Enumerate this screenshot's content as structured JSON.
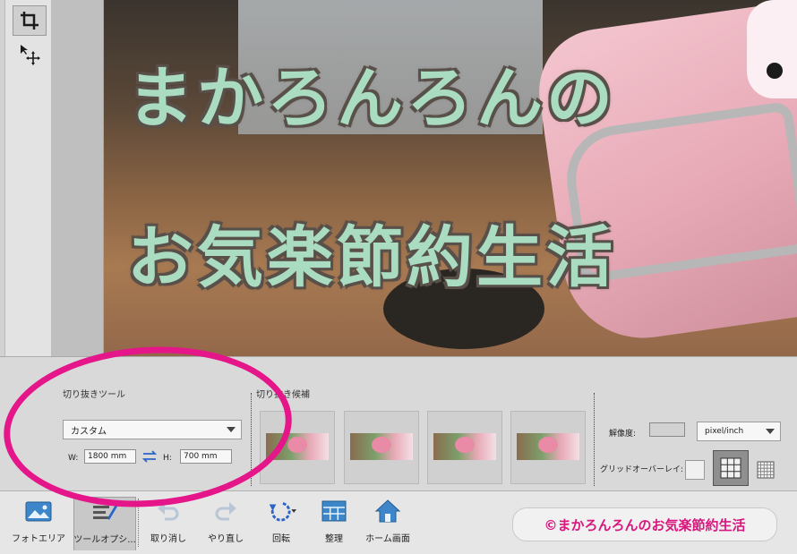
{
  "canvas": {
    "title_line1": "まかろんろんの",
    "title_line2": "お気楽節約生活"
  },
  "tools": {
    "crop": "crop-tool",
    "move": "move-tool"
  },
  "options": {
    "crop_section_label": "切り抜きツール",
    "preset_selected": "カスタム",
    "width_label": "W:",
    "width_value": "1800 mm",
    "height_label": "H:",
    "height_value": "700 mm",
    "suggestions_label": "切り抜き候補",
    "suggestion_count": 4,
    "resolution_label": "解像度:",
    "resolution_value": "",
    "unit_selected": "pixel/inch",
    "grid_overlay_label": "グリッドオーバーレイ:",
    "grid_selected": "thirds"
  },
  "taskbar": {
    "photo_area": "フォトエリア",
    "tool_options": "ツールオプシ...",
    "undo": "取り消し",
    "redo": "やり直し",
    "rotate": "回転",
    "organize": "整理",
    "home": "ホーム画面"
  },
  "watermark": "©まかろんろんのお気楽節約生活",
  "colors": {
    "annotation": "#e5158a",
    "title_text": "#a9dcc0",
    "watermark_text": "#d8177e"
  }
}
